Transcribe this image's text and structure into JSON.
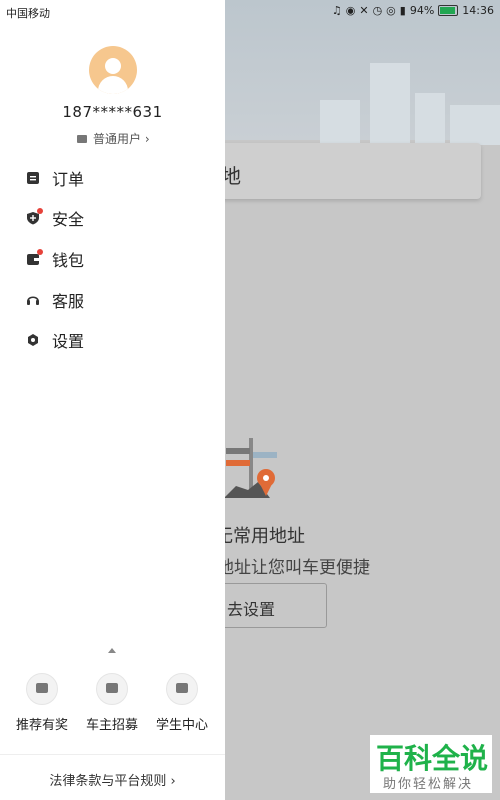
{
  "status_bar": {
    "carrier": "中国移动",
    "battery": "94%",
    "time": "14:36",
    "battery_level": 0.94
  },
  "profile": {
    "phone": "187*****631",
    "user_type": "普通用户 ›"
  },
  "menu": [
    {
      "label": "订单",
      "icon": "order-icon"
    },
    {
      "label": "安全",
      "icon": "shield-icon",
      "dot": true
    },
    {
      "label": "钱包",
      "icon": "wallet-icon",
      "dot": true
    },
    {
      "label": "客服",
      "icon": "headset-icon"
    },
    {
      "label": "设置",
      "icon": "gear-icon"
    }
  ],
  "promos": [
    {
      "label": "推荐有奖",
      "icon": "gift-icon"
    },
    {
      "label": "车主招募",
      "icon": "driver-icon"
    },
    {
      "label": "学生中心",
      "icon": "graduation-cap-icon"
    }
  ],
  "legal_link": "法律条款与平台规则 ›",
  "background": {
    "search_text": "地",
    "empty_title": "无常用地址",
    "empty_subtitle": "地址让您叫车更便捷",
    "set_button": "去设置"
  },
  "watermark": {
    "main": "百科全说",
    "sub": "助你轻松解决"
  },
  "colors": {
    "accent_green": "#1fb24a",
    "badge_red": "#e6423a",
    "avatar": "#f6c78e",
    "pin_orange": "#e06b37"
  }
}
